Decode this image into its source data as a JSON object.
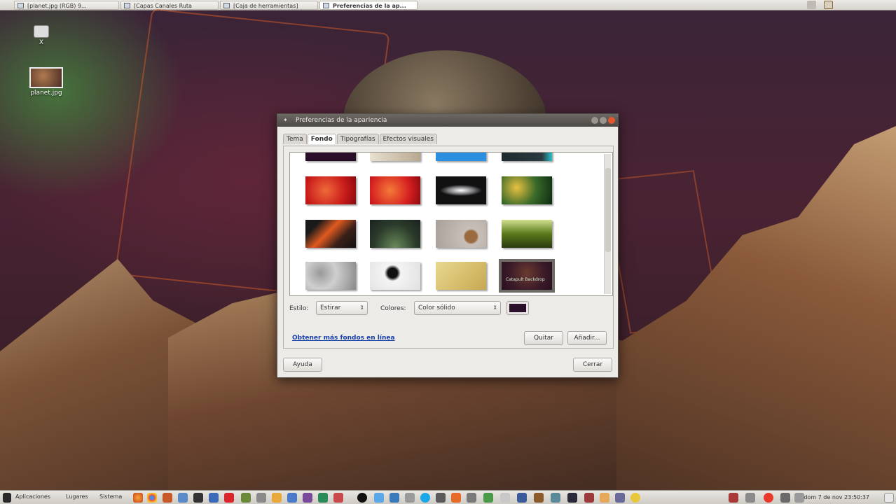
{
  "top_bar": {
    "tasks": [
      {
        "label": "[planet.jpg (RGB) 9..."
      },
      {
        "label": "[Capas Canales Ruta"
      },
      {
        "label": "[Caja de herramientas]"
      },
      {
        "label": "Preferencias de la ap..."
      }
    ]
  },
  "desktop": {
    "icons": [
      {
        "label": "X"
      },
      {
        "label": "planet.jpg"
      }
    ]
  },
  "dialog": {
    "title": "Preferencias de la apariencia",
    "tabs": [
      {
        "label": "Tema"
      },
      {
        "label": "Fondo"
      },
      {
        "label": "Tipografías"
      },
      {
        "label": "Efectos visuales"
      }
    ],
    "active_tab": "Fondo",
    "style_label": "Estilo:",
    "style_value": "Estirar",
    "colors_label": "Colores:",
    "colors_value": "Color sólido",
    "swatch_color": "#2a0d28",
    "link_text": "Obtener más fondos en línea",
    "remove_button": "Quitar",
    "add_button": "Añadir...",
    "help_button": "Ayuda",
    "close_button": "Cerrar",
    "selected_thumbnail_caption": "Catapult Backdrop"
  },
  "bottom_bar": {
    "menus": [
      "Aplicaciones",
      "Lugares",
      "Sistema"
    ],
    "clock": "dom 7 de nov 23:50:37"
  },
  "colors": {
    "link": "#1a3fa8",
    "titlebar": "#5c5853",
    "dialog_bg": "#edebe8"
  }
}
